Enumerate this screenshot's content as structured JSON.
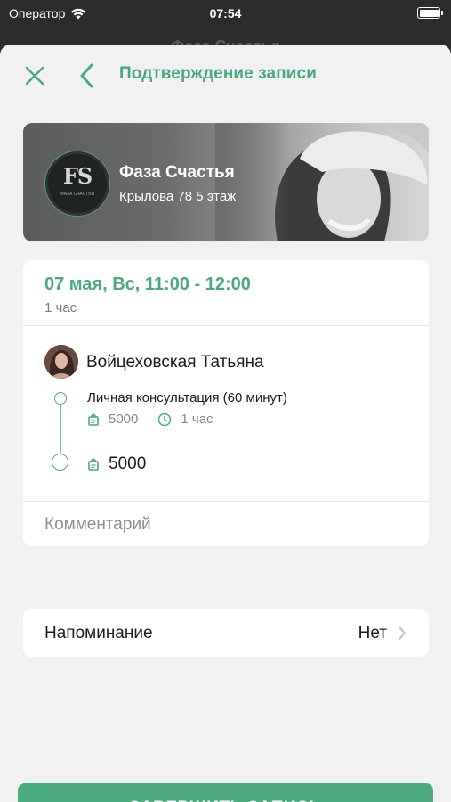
{
  "status_bar": {
    "carrier": "Оператор",
    "time": "07:54"
  },
  "background_screen": {
    "title": "Фаза Счастья"
  },
  "header": {
    "title": "Подтверждение записи",
    "close_icon": "close-icon",
    "back_icon": "chevron-left-icon"
  },
  "studio": {
    "name": "Фаза Счастья",
    "address": "Крылова 78 5 этаж",
    "logo_text": "FS",
    "logo_caption": "ФАЗА СЧАСТЬЯ"
  },
  "booking": {
    "date_time": "07 мая, Вс, 11:00 - 12:00",
    "duration": "1 час",
    "specialist": "Войцеховская Татьяна",
    "service": {
      "name": "Личная консультация (60 минут)",
      "price": "5000",
      "duration": "1 час"
    },
    "total": "5000",
    "comment_placeholder": "Комментарий"
  },
  "reminder": {
    "label": "Напоминание",
    "value": "Нет"
  },
  "submit": {
    "label": "ЗАВЕРШИТЬ ЗАПИСЬ"
  },
  "colors": {
    "accent": "#4aaa7c",
    "button": "#4dac7f",
    "background": "#f1f1f3"
  }
}
